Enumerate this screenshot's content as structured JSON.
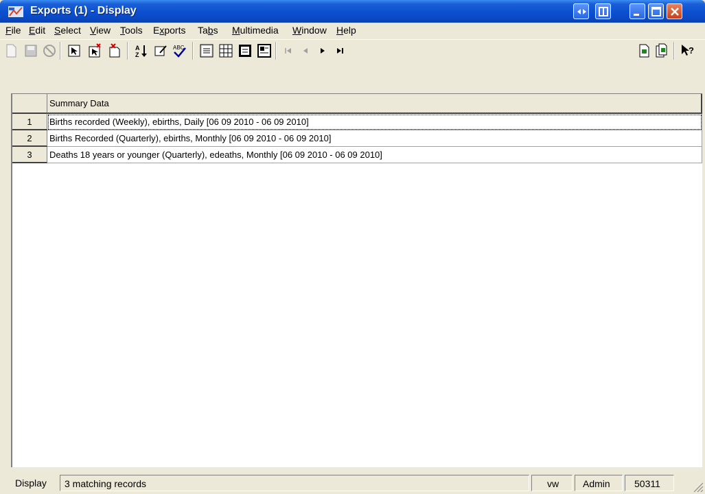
{
  "window": {
    "title": "Exports (1) - Display"
  },
  "menu": [
    {
      "u": "F",
      "rest": "ile"
    },
    {
      "u": "E",
      "rest": "dit"
    },
    {
      "u": "S",
      "rest": "elect"
    },
    {
      "u": "V",
      "rest": "iew"
    },
    {
      "u": "T",
      "rest": "ools"
    },
    {
      "pre": "E",
      "u": "x",
      "rest": "ports"
    },
    {
      "pre": "Ta",
      "u": "b",
      "rest": "s"
    },
    {
      "u": "M",
      "rest": "ultimedia"
    },
    {
      "u": "W",
      "rest": "indow"
    },
    {
      "u": "H",
      "rest": "elp"
    }
  ],
  "toolbar": {
    "icons": [
      "new-icon",
      "save-icon",
      "cancel-icon",
      "select-icon",
      "select-new-icon",
      "deselect-icon",
      "sort-icon",
      "edit-icon",
      "spellcheck-icon",
      "list-view-icon",
      "table-view-icon",
      "form-view-icon",
      "image-view-icon",
      "first-record-icon",
      "previous-record-icon",
      "next-record-icon",
      "last-record-icon",
      "report-icon",
      "report-copy-icon",
      "help-pointer-icon"
    ]
  },
  "grid": {
    "column_header": "Summary Data",
    "rows": [
      {
        "num": "1",
        "value": "Births recorded (Weekly), ebirths, Daily [06 09 2010 - 06 09 2010]"
      },
      {
        "num": "2",
        "value": "Births Recorded (Quarterly), ebirths, Monthly [06 09 2010 - 06 09 2010]"
      },
      {
        "num": "3",
        "value": "Deaths 18 years or younger (Quarterly), edeaths, Monthly [06 09 2010 - 06 09 2010]"
      }
    ]
  },
  "status": {
    "mode": "Display",
    "records": "3 matching records",
    "user_short": "vw",
    "user": "Admin",
    "count": "50311"
  },
  "colors": {
    "titlebar": "#0b4fd0",
    "chrome": "#ece9d8"
  }
}
